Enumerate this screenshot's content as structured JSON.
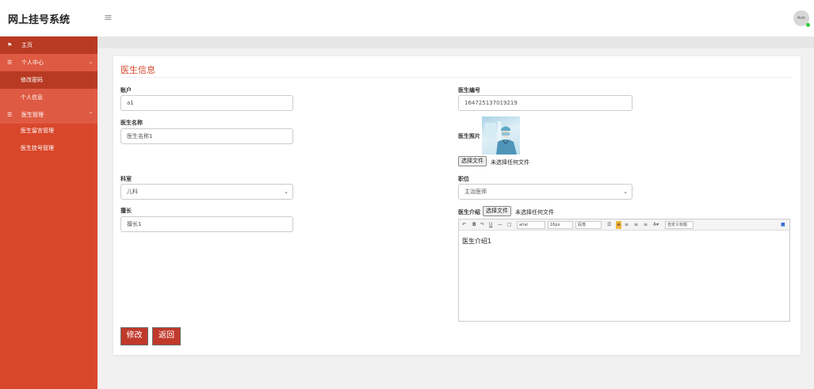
{
  "app": {
    "title": "网上挂号系统",
    "menu_toggle": "≡",
    "avatar_text": "Math"
  },
  "sidebar": {
    "home": "主页",
    "personal_center": "个人中心",
    "change_password": "修改密码",
    "personal_info": "个人信息",
    "doctor_management": "医生管理",
    "doctor_message_management": "医生留言管理",
    "doctor_registration_management": "医生挂号管理"
  },
  "card": {
    "title": "医生信息"
  },
  "form": {
    "account": {
      "label": "账户",
      "value": "a1"
    },
    "doctor_no": {
      "label": "医生编号",
      "value": "1647251370192​19"
    },
    "doctor_name": {
      "label": "医生名称",
      "value": "医生名称1"
    },
    "doctor_photo": {
      "label": "医生照片"
    },
    "photo_file": {
      "button": "选择文件",
      "text": "未选择任何文件"
    },
    "department": {
      "label": "科室",
      "value": "儿科"
    },
    "position": {
      "label": "职位",
      "value": "主治医师"
    },
    "specialty": {
      "label": "擅长",
      "value": "擅长1"
    },
    "intro": {
      "label": "医生介绍",
      "file_button": "选择文件",
      "file_text": "未选择任何文件",
      "content": "医生介绍1"
    }
  },
  "editor_toolbar": {
    "font_family": "arial",
    "font_size": "16px",
    "paragraph": "段落",
    "custom_title": "自定义标题"
  },
  "buttons": {
    "modify": "修改",
    "back": "返回"
  },
  "colors": {
    "accent": "#d9472b",
    "sidebar_bg": "#d9472b",
    "button_bg": "#c0392b"
  }
}
